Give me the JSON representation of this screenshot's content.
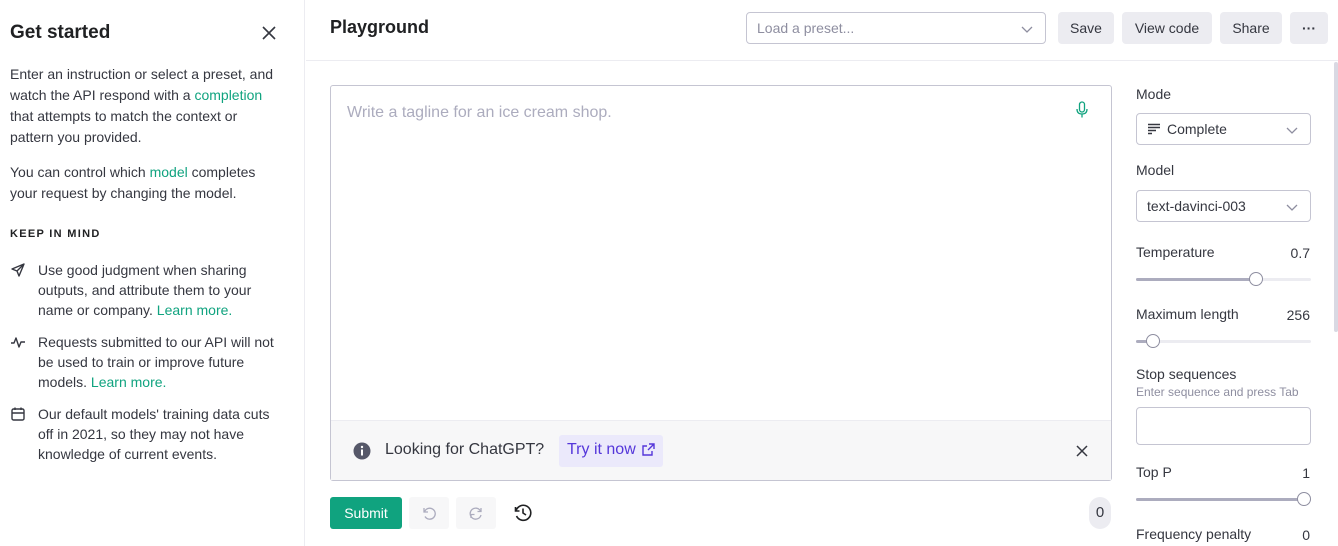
{
  "sidebar": {
    "title": "Get started",
    "intro_before": "Enter an instruction or select a preset, and watch the API respond with a ",
    "intro_link": "completion",
    "intro_after": " that attempts to match the context or pattern you provided.",
    "model_before": "You can control which ",
    "model_link": "model",
    "model_after": " completes your request by changing the model.",
    "keep_in_mind": "KEEP IN MIND",
    "tips": [
      {
        "icon": "send-icon",
        "text": "Use good judgment when sharing outputs, and attribute them to your name or company. ",
        "link": "Learn more."
      },
      {
        "icon": "activity-icon",
        "text": "Requests submitted to our API will not be used to train or improve future models. ",
        "link": "Learn more."
      },
      {
        "icon": "calendar-icon",
        "text": "Our default models' training data cuts off in 2021, so they may not have knowledge of current events.",
        "link": ""
      }
    ]
  },
  "header": {
    "title": "Playground",
    "preset_placeholder": "Load a preset...",
    "save_label": "Save",
    "view_code_label": "View code",
    "share_label": "Share",
    "more_label": "···"
  },
  "editor": {
    "placeholder": "Write a tagline for an ice cream shop.",
    "chatgpt_prompt": "Looking for ChatGPT?",
    "try_label": "Try it now"
  },
  "footer": {
    "submit_label": "Submit",
    "token_count": "0"
  },
  "settings": {
    "mode_label": "Mode",
    "mode_value": "Complete",
    "model_label": "Model",
    "model_value": "text-davinci-003",
    "temperature_label": "Temperature",
    "temperature_value": "0.7",
    "temperature_fraction": 0.7,
    "max_length_label": "Maximum length",
    "max_length_value": "256",
    "max_length_fraction": 0.06,
    "stop_label": "Stop sequences",
    "stop_hint": "Enter sequence and press Tab",
    "top_p_label": "Top P",
    "top_p_value": "1",
    "top_p_fraction": 1.0,
    "freq_label": "Frequency penalty",
    "freq_value": "0"
  },
  "colors": {
    "accent": "#10a37f",
    "link_purple": "#5436da"
  }
}
